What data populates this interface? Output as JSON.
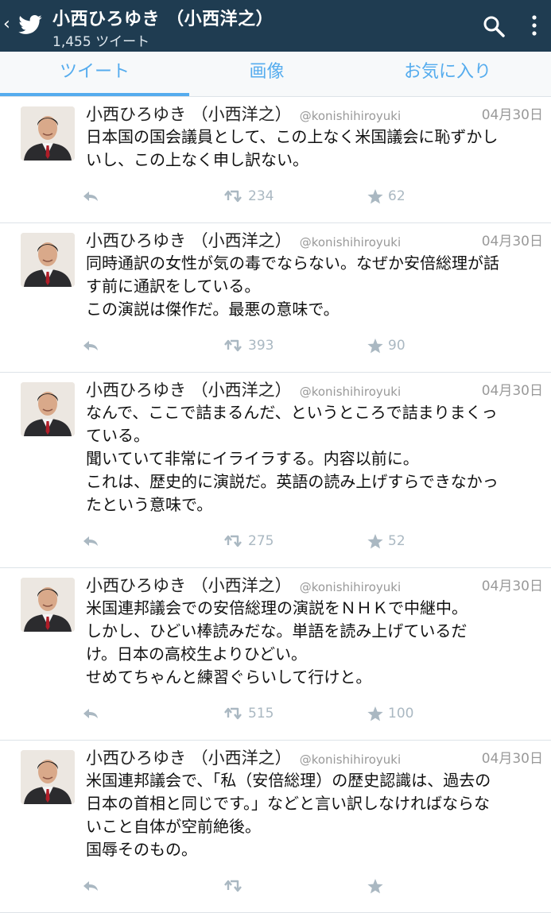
{
  "header": {
    "back_glyph": "‹",
    "title": "小西ひろゆき （小西洋之）",
    "subtitle": "1,455 ツイート"
  },
  "tabs": [
    {
      "label": "ツイート",
      "active": true
    },
    {
      "label": "画像",
      "active": false
    },
    {
      "label": "お気に入り",
      "active": false
    }
  ],
  "colors": {
    "appbar": "#1f3c51",
    "accent": "#55acee",
    "muted": "#aab8c2"
  },
  "tweets": [
    {
      "name": "小西ひろゆき （小西洋之）",
      "handle": "@konishihiroyuki",
      "date": "04月30日",
      "text": "日本国の国会議員として、この上なく米国議会に恥ずかし\nいし、この上なく申し訳ない。",
      "retweets": "234",
      "favorites": "62"
    },
    {
      "name": "小西ひろゆき （小西洋之）",
      "handle": "@konishihiroyuki",
      "date": "04月30日",
      "text": "同時通訳の女性が気の毒でならない。なぜか安倍総理が話\nす前に通訳をしている。\nこの演説は傑作だ。最悪の意味で。",
      "retweets": "393",
      "favorites": "90"
    },
    {
      "name": "小西ひろゆき （小西洋之）",
      "handle": "@konishihiroyuki",
      "date": "04月30日",
      "text": "なんで、ここで詰まるんだ、というところで詰まりまくっ\nている。\n聞いていて非常にイライラする。内容以前に。\nこれは、歴史的に演説だ。英語の読み上げすらできなかっ\nたという意味で。",
      "retweets": "275",
      "favorites": "52"
    },
    {
      "name": "小西ひろゆき （小西洋之）",
      "handle": "@konishihiroyuki",
      "date": "04月30日",
      "text": "米国連邦議会での安倍総理の演説をＮＨＫで中継中。\nしかし、ひどい棒読みだな。単語を読み上げているだ\nけ。日本の高校生よりひどい。\nせめてちゃんと練習ぐらいして行けと。",
      "retweets": "515",
      "favorites": "100"
    },
    {
      "name": "小西ひろゆき （小西洋之）",
      "handle": "@konishihiroyuki",
      "date": "04月30日",
      "text": "米国連邦議会で、「私（安倍総理）の歴史認識は、過去の\n日本の首相と同じです。」などと言い訳しなければならな\nいこと自体が空前絶後。\n国辱そのもの。",
      "retweets": "",
      "favorites": ""
    }
  ]
}
